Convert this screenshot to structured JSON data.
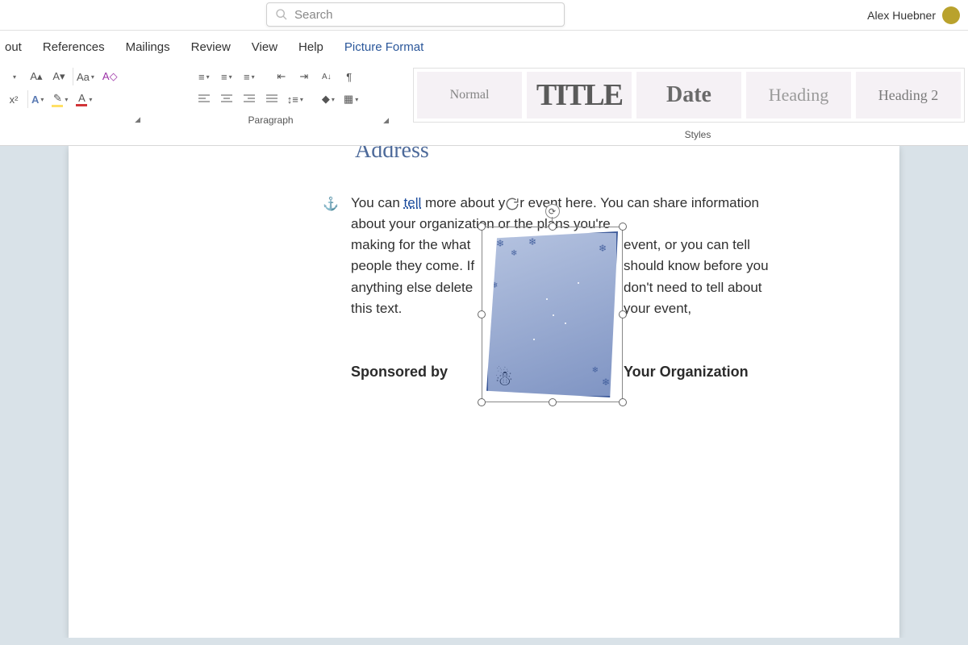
{
  "titlebar": {
    "search_placeholder": "Search",
    "user_name": "Alex Huebner"
  },
  "tabs": {
    "items": [
      "out",
      "References",
      "Mailings",
      "Review",
      "View",
      "Help",
      "Picture Format"
    ],
    "active_index": 6
  },
  "ribbon": {
    "font": {
      "grow_font": "A▴",
      "shrink_font": "A▾",
      "change_case": "Aa",
      "clear_format": "A◇",
      "superscript": "x²",
      "text_effects": "A",
      "highlight": "ab",
      "font_color": "A"
    },
    "paragraph": {
      "label": "Paragraph",
      "bullets": "•≡",
      "numbering": "1≡",
      "multilevel": "≡",
      "dec_indent": "⇤",
      "inc_indent": "⇥",
      "sort": "A↓Z",
      "pilcrow": "¶",
      "align_left": "≡",
      "align_center": "≡",
      "align_right": "≡",
      "justify": "≡",
      "line_spacing": "↕≡",
      "shading": "◇",
      "borders": "▦"
    },
    "styles": {
      "label": "Styles",
      "tiles": [
        "Normal",
        "TITLE",
        "Date",
        "Heading",
        "Heading 2"
      ]
    }
  },
  "document": {
    "heading_partial": "Address",
    "line1_a": "You can ",
    "line1_link": "tell",
    "line1_b": " more about y",
    "line1_c": "r event here. You can share",
    "line2": "information about your organization or the plans you're",
    "left_col": "making for the what people they come. If anything else delete this text.",
    "right_col": "event, or you can tell should know before you don't need to tell about your event,",
    "sponsored": "Sponsored by",
    "organization": "Your Organization"
  }
}
